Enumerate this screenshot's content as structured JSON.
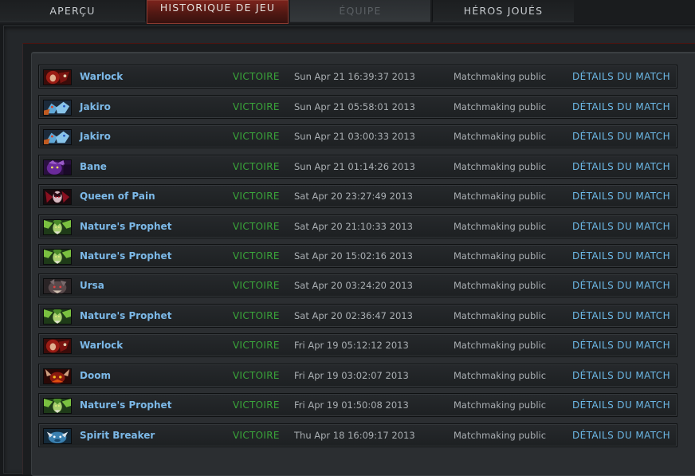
{
  "tabs": [
    {
      "label": "APERÇU",
      "state": "normal"
    },
    {
      "label": "HISTORIQUE DE JEU",
      "state": "active"
    },
    {
      "label": "ÉQUIPE",
      "state": "disabled"
    },
    {
      "label": "HÉROS JOUÉS",
      "state": "normal"
    }
  ],
  "colors": {
    "hero_name": "#7cb9e8",
    "victory": "#3aa43a",
    "link": "#6cb8e6",
    "active_tab": "#5a1a14"
  },
  "matches": [
    {
      "hero": "Warlock",
      "hero_icon": "warlock-portrait-icon",
      "result": "VICTOIRE",
      "date": "Sun Apr 21 16:39:37 2013",
      "mode": "Matchmaking public",
      "details": "DÉTAILS DU MATCH"
    },
    {
      "hero": "Jakiro",
      "hero_icon": "jakiro-portrait-icon",
      "result": "VICTOIRE",
      "date": "Sun Apr 21 05:58:01 2013",
      "mode": "Matchmaking public",
      "details": "DÉTAILS DU MATCH"
    },
    {
      "hero": "Jakiro",
      "hero_icon": "jakiro-portrait-icon",
      "result": "VICTOIRE",
      "date": "Sun Apr 21 03:00:33 2013",
      "mode": "Matchmaking public",
      "details": "DÉTAILS DU MATCH"
    },
    {
      "hero": "Bane",
      "hero_icon": "bane-portrait-icon",
      "result": "VICTOIRE",
      "date": "Sun Apr 21 01:14:26 2013",
      "mode": "Matchmaking public",
      "details": "DÉTAILS DU MATCH"
    },
    {
      "hero": "Queen of Pain",
      "hero_icon": "queen-of-pain-portrait-icon",
      "result": "VICTOIRE",
      "date": "Sat Apr 20 23:27:49 2013",
      "mode": "Matchmaking public",
      "details": "DÉTAILS DU MATCH"
    },
    {
      "hero": "Nature's Prophet",
      "hero_icon": "natures-prophet-portrait-icon",
      "result": "VICTOIRE",
      "date": "Sat Apr 20 21:10:33 2013",
      "mode": "Matchmaking public",
      "details": "DÉTAILS DU MATCH"
    },
    {
      "hero": "Nature's Prophet",
      "hero_icon": "natures-prophet-portrait-icon",
      "result": "VICTOIRE",
      "date": "Sat Apr 20 15:02:16 2013",
      "mode": "Matchmaking public",
      "details": "DÉTAILS DU MATCH"
    },
    {
      "hero": "Ursa",
      "hero_icon": "ursa-portrait-icon",
      "result": "VICTOIRE",
      "date": "Sat Apr 20 03:24:20 2013",
      "mode": "Matchmaking public",
      "details": "DÉTAILS DU MATCH"
    },
    {
      "hero": "Nature's Prophet",
      "hero_icon": "natures-prophet-portrait-icon",
      "result": "VICTOIRE",
      "date": "Sat Apr 20 02:36:47 2013",
      "mode": "Matchmaking public",
      "details": "DÉTAILS DU MATCH"
    },
    {
      "hero": "Warlock",
      "hero_icon": "warlock-portrait-icon",
      "result": "VICTOIRE",
      "date": "Fri Apr 19 05:12:12 2013",
      "mode": "Matchmaking public",
      "details": "DÉTAILS DU MATCH"
    },
    {
      "hero": "Doom",
      "hero_icon": "doom-portrait-icon",
      "result": "VICTOIRE",
      "date": "Fri Apr 19 03:02:07 2013",
      "mode": "Matchmaking public",
      "details": "DÉTAILS DU MATCH"
    },
    {
      "hero": "Nature's Prophet",
      "hero_icon": "natures-prophet-portrait-icon",
      "result": "VICTOIRE",
      "date": "Fri Apr 19 01:50:08 2013",
      "mode": "Matchmaking public",
      "details": "DÉTAILS DU MATCH"
    },
    {
      "hero": "Spirit Breaker",
      "hero_icon": "spirit-breaker-portrait-icon",
      "result": "VICTOIRE",
      "date": "Thu Apr 18 16:09:17 2013",
      "mode": "Matchmaking public",
      "details": "DÉTAILS DU MATCH"
    }
  ]
}
